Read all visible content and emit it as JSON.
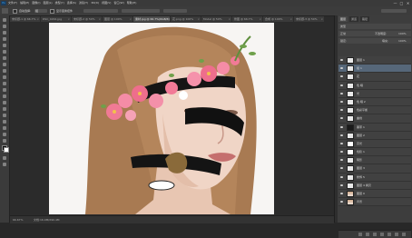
{
  "app": {
    "logo": "Ps"
  },
  "menubar": {
    "items": [
      "文件(F)",
      "编辑(E)",
      "图像(I)",
      "图层(L)",
      "类型(Y)",
      "选择(S)",
      "滤镜(T)",
      "3D(D)",
      "视图(V)",
      "窗口(W)",
      "帮助(H)"
    ],
    "window_buttons": [
      "—",
      "□",
      "✕"
    ]
  },
  "options_bar": {
    "auto_select_label": "自动选择:",
    "auto_select_value": "组",
    "transform_label": "显示变换控件"
  },
  "tabs": [
    {
      "label": "未标题-1 @ 66.7%",
      "active": false
    },
    {
      "label": "DSC_0291.jpg",
      "active": false
    },
    {
      "label": "未标题-2 @ 50%",
      "active": false
    },
    {
      "label": "图层 @ 100%",
      "active": false
    },
    {
      "label": "素材.jpg @ 66.7%(RGB/8)",
      "active": true
    },
    {
      "label": "花.png @ 100%",
      "active": false
    },
    {
      "label": "Model @ 50%",
      "active": false
    },
    {
      "label": "修图 @ 66.7%",
      "active": false
    },
    {
      "label": "合成 @ 100%",
      "active": false
    },
    {
      "label": "未标题-3 @ 50%",
      "active": false
    }
  ],
  "statusbar": {
    "zoom": "66.67%",
    "doc_info": "文档:16.9M/290.4M"
  },
  "panels": {
    "tabs": [
      "图层",
      "通道",
      "路径"
    ],
    "kind_label": "类型",
    "blend_mode": "正常",
    "opacity_label": "不透明度:",
    "opacity_value": "100%",
    "lock_label": "锁定:",
    "fill_label": "填充:",
    "fill_value": "100%"
  },
  "layers": [
    {
      "name": "图层 1",
      "thumb": "plain",
      "selected": false
    },
    {
      "name": "组 1",
      "thumb": "plain",
      "selected": true
    },
    {
      "name": "花",
      "thumb": "plain",
      "selected": false
    },
    {
      "name": "色 暗",
      "thumb": "plain",
      "selected": false
    },
    {
      "name": "光",
      "thumb": "plain",
      "selected": false
    },
    {
      "name": "色 暗 2",
      "thumb": "plain",
      "selected": false
    },
    {
      "name": "色彩平衡",
      "thumb": "plain",
      "selected": false
    },
    {
      "name": "曲线",
      "thumb": "plain",
      "selected": false
    },
    {
      "name": "黑带 1",
      "thumb": "dark",
      "selected": false
    },
    {
      "name": "图层 2",
      "thumb": "plain",
      "selected": false
    },
    {
      "name": "高光",
      "thumb": "mask",
      "selected": false
    },
    {
      "name": "色阶 1",
      "thumb": "mask",
      "selected": false
    },
    {
      "name": "阴影",
      "thumb": "plain",
      "selected": false
    },
    {
      "name": "图层 3",
      "thumb": "plain",
      "selected": false
    },
    {
      "name": "修饰 5",
      "thumb": "plain",
      "selected": false
    },
    {
      "name": "图层 4 拷贝",
      "thumb": "plain",
      "selected": false
    },
    {
      "name": "图层 0",
      "thumb": "photo",
      "selected": false
    },
    {
      "name": "背景",
      "thumb": "photo",
      "selected": false
    }
  ],
  "colors": {
    "accent_selected_layer": "#566779",
    "ui_dark": "#282828"
  }
}
